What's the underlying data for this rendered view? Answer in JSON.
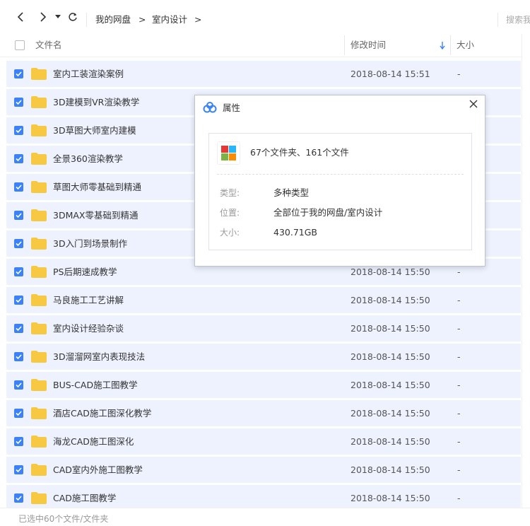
{
  "nav": {
    "breadcrumb": [
      "我的网盘",
      "室内设计"
    ],
    "separator": ">",
    "search_placeholder": "搜索我的网盘文件"
  },
  "columns": {
    "name": "文件名",
    "modified": "修改时间",
    "size": "大小"
  },
  "files": [
    {
      "name": "室内工装渲染案例",
      "modified": "2018-08-14 15:51",
      "size": "-"
    },
    {
      "name": "3D建模到VR渲染教学",
      "modified": "",
      "size": ""
    },
    {
      "name": "3D草图大师室内建模",
      "modified": "",
      "size": ""
    },
    {
      "name": "全景360渲染教学",
      "modified": "",
      "size": ""
    },
    {
      "name": "草图大师零基础到精通",
      "modified": "",
      "size": ""
    },
    {
      "name": "3DMAX零基础到精通",
      "modified": "",
      "size": ""
    },
    {
      "name": "3D入门到场景制作",
      "modified": "",
      "size": ""
    },
    {
      "name": "PS后期速成教学",
      "modified": "2018-08-14 15:50",
      "size": "-"
    },
    {
      "name": "马良施工工艺讲解",
      "modified": "2018-08-14 15:50",
      "size": "-"
    },
    {
      "name": "室内设计经验杂谈",
      "modified": "2018-08-14 15:50",
      "size": "-"
    },
    {
      "name": "3D溜溜网室内表现技法",
      "modified": "2018-08-14 15:50",
      "size": "-"
    },
    {
      "name": "BUS-CAD施工图教学",
      "modified": "2018-08-14 15:50",
      "size": "-"
    },
    {
      "name": "酒店CAD施工图深化教学",
      "modified": "2018-08-14 15:50",
      "size": "-"
    },
    {
      "name": "海龙CAD施工图深化",
      "modified": "2018-08-14 15:50",
      "size": "-"
    },
    {
      "name": "CAD室内外施工图教学",
      "modified": "2018-08-14 15:50",
      "size": "-"
    },
    {
      "name": "CAD施工图教学",
      "modified": "2018-08-14 15:50",
      "size": "-"
    }
  ],
  "status": "已选中60个文件/文件夹",
  "dialog": {
    "title": "属性",
    "summary": "67个文件夹、161个文件",
    "props": [
      {
        "label": "类型:",
        "value": "多种类型"
      },
      {
        "label": "位置:",
        "value": "全部位于我的网盘/室内设计"
      },
      {
        "label": "大小:",
        "value": "430.71GB"
      }
    ]
  },
  "colors": {
    "accent": "#3b82f6",
    "folder": "#f7c842",
    "row_selected": "#eef2ff"
  }
}
